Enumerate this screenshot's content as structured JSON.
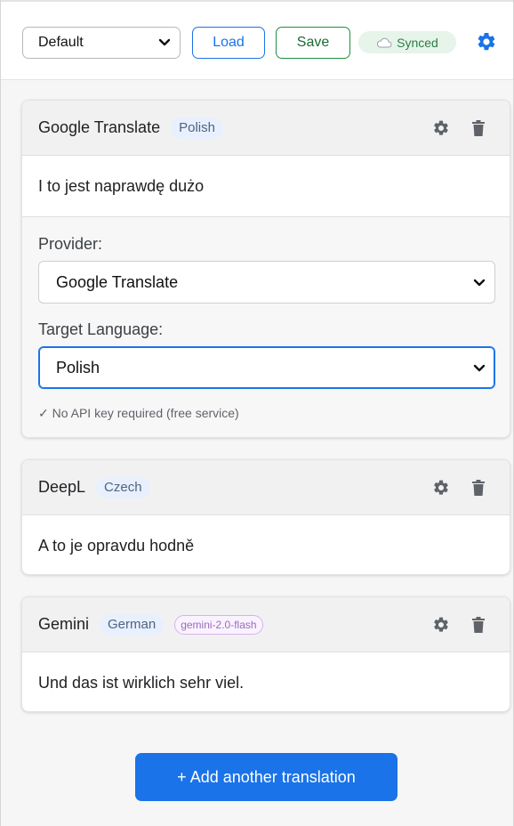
{
  "toolbar": {
    "profile_value": "Default",
    "load_label": "Load",
    "save_label": "Save",
    "sync_status": "Synced",
    "sync_icon": "cloud-icon",
    "settings_icon": "gear-icon"
  },
  "translations": [
    {
      "provider": "Google Translate",
      "language": "Polish",
      "text": "I to jest naprawdę dużo",
      "settings": {
        "provider_label": "Provider:",
        "provider_value": "Google Translate",
        "language_label": "Target Language:",
        "language_value": "Polish",
        "hint": "✓ No API key required (free service)"
      }
    },
    {
      "provider": "DeepL",
      "language": "Czech",
      "text": "A to je opravdu hodně"
    },
    {
      "provider": "Gemini",
      "language": "German",
      "model": "gemini-2.0-flash",
      "text": "Und das ist wirklich sehr viel."
    }
  ],
  "add_button_label": "+ Add another translation",
  "colors": {
    "accent": "#1a73e8",
    "save": "#1e8e3e",
    "synced_bg": "#e6f4ea",
    "language_badge_bg": "#e8f0fe",
    "model_badge_border": "#d7b0ee"
  }
}
